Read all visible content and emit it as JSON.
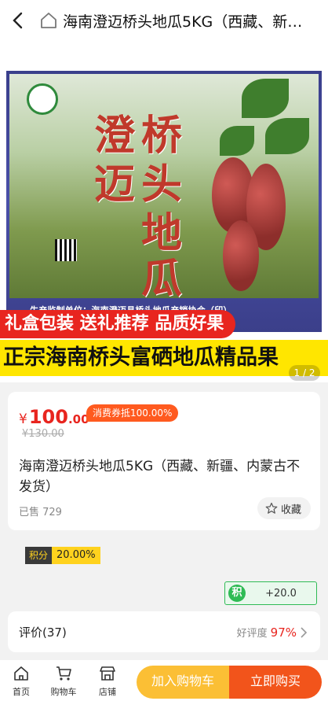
{
  "header": {
    "title": "海南澄迈桥头地瓜5KG（西藏、新疆、内蒙古不发货）",
    "back_icon": "chevron-left-icon",
    "home_icon": "home-icon"
  },
  "banner": {
    "big_title": "澄迈桥头地瓜",
    "producer_text": "生产监制单位：海南澄迈县桥头地瓜产销协会（印）",
    "slogan_red": "礼盒包装 送礼推荐 品质好果",
    "slogan_yellow": "正宗海南桥头富硒地瓜精品果",
    "pager": "1 / 2"
  },
  "product": {
    "currency": "¥",
    "price_int": "100",
    "price_dec": ".00",
    "coupon": "消费券抵100.00%",
    "original_price": "¥130.00",
    "name": "海南澄迈桥头地瓜5KG（西藏、新疆、内蒙古不发货）",
    "sold": "已售 729",
    "favorite_label": "收藏"
  },
  "points": {
    "label": "积分",
    "value": "20.00%"
  },
  "reward": {
    "badge": "积",
    "value": "+20.0"
  },
  "reviews": {
    "label": "评价(37)",
    "good_label": "好评度",
    "good_pct": "97%"
  },
  "tabbar": {
    "home": "首页",
    "cart": "购物车",
    "shop": "店铺",
    "add_to_cart": "加入购物车",
    "buy_now": "立即购买"
  },
  "colors": {
    "accent_red": "#e8251f",
    "coupon_orange": "#ff5a1f",
    "cart_yellow": "#fbbf35",
    "buy_orange": "#f2541b",
    "reward_green": "#2fbb55"
  }
}
